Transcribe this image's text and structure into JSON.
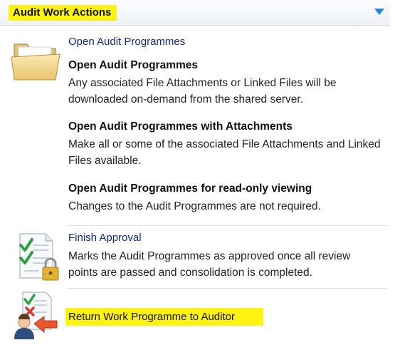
{
  "panel": {
    "title": "Audit Work Actions",
    "collapse_icon": "chevron-down-icon",
    "accent": "#1d7fd6",
    "highlight": "#fef212"
  },
  "open": {
    "title": "Open Audit Programmes",
    "icon": "folder-icon",
    "options": [
      {
        "title": "Open Audit Programmes",
        "desc": "Any associated File Attachments or Linked Files will be downloaded on-demand from the shared server."
      },
      {
        "title": "Open Audit Programmes with Attachments",
        "desc": "Make all or some of the associated File Attachments and Linked Files available."
      },
      {
        "title": "Open Audit Programmes for read-only viewing",
        "desc": "Changes to the Audit Programmes are not required."
      }
    ]
  },
  "finish": {
    "title": "Finish Approval",
    "icon": "approved-document-lock-icon",
    "desc": "Marks the Audit Programmes as approved once all review points are passed and consolidation is completed."
  },
  "return": {
    "title": "Return Work Programme to Auditor",
    "icon": "return-to-auditor-icon"
  }
}
